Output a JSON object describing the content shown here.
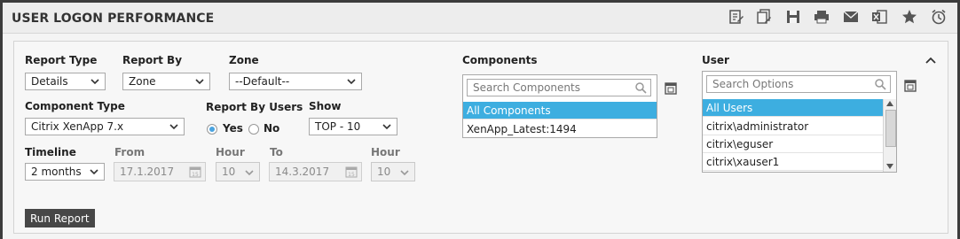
{
  "header": {
    "title": "USER LOGON PERFORMANCE",
    "tools": [
      "edit-report-icon",
      "edit-filter-icon",
      "save-icon",
      "print-icon",
      "mail-icon",
      "excel-export-icon",
      "favorite-star-icon",
      "alarm-clock-icon"
    ]
  },
  "form": {
    "report_type": {
      "label": "Report Type",
      "value": "Details"
    },
    "report_by": {
      "label": "Report By",
      "value": "Zone"
    },
    "zone": {
      "label": "Zone",
      "value": "--Default--"
    },
    "component_type": {
      "label": "Component Type",
      "value": "Citrix XenApp 7.x"
    },
    "report_by_users": {
      "label": "Report By Users",
      "yes": "Yes",
      "no": "No",
      "selected": "Yes"
    },
    "show": {
      "label": "Show",
      "value": "TOP - 10"
    },
    "timeline": {
      "label": "Timeline",
      "value": "2 months"
    },
    "from": {
      "label": "From",
      "value": "17.1.2017"
    },
    "from_hour": {
      "label": "Hour",
      "value": "10"
    },
    "to": {
      "label": "To",
      "value": "14.3.2017"
    },
    "to_hour": {
      "label": "Hour",
      "value": "10"
    },
    "run_button": "Run Report"
  },
  "components": {
    "label": "Components",
    "search_placeholder": "Search Components",
    "items": [
      "All Components",
      "XenApp_Latest:1494"
    ]
  },
  "user": {
    "label": "User",
    "search_placeholder": "Search Options",
    "items": [
      "All Users",
      "citrix\\administrator",
      "citrix\\eguser",
      "citrix\\xauser1"
    ]
  },
  "colors": {
    "accent": "#3daee0",
    "button": "#474747"
  }
}
